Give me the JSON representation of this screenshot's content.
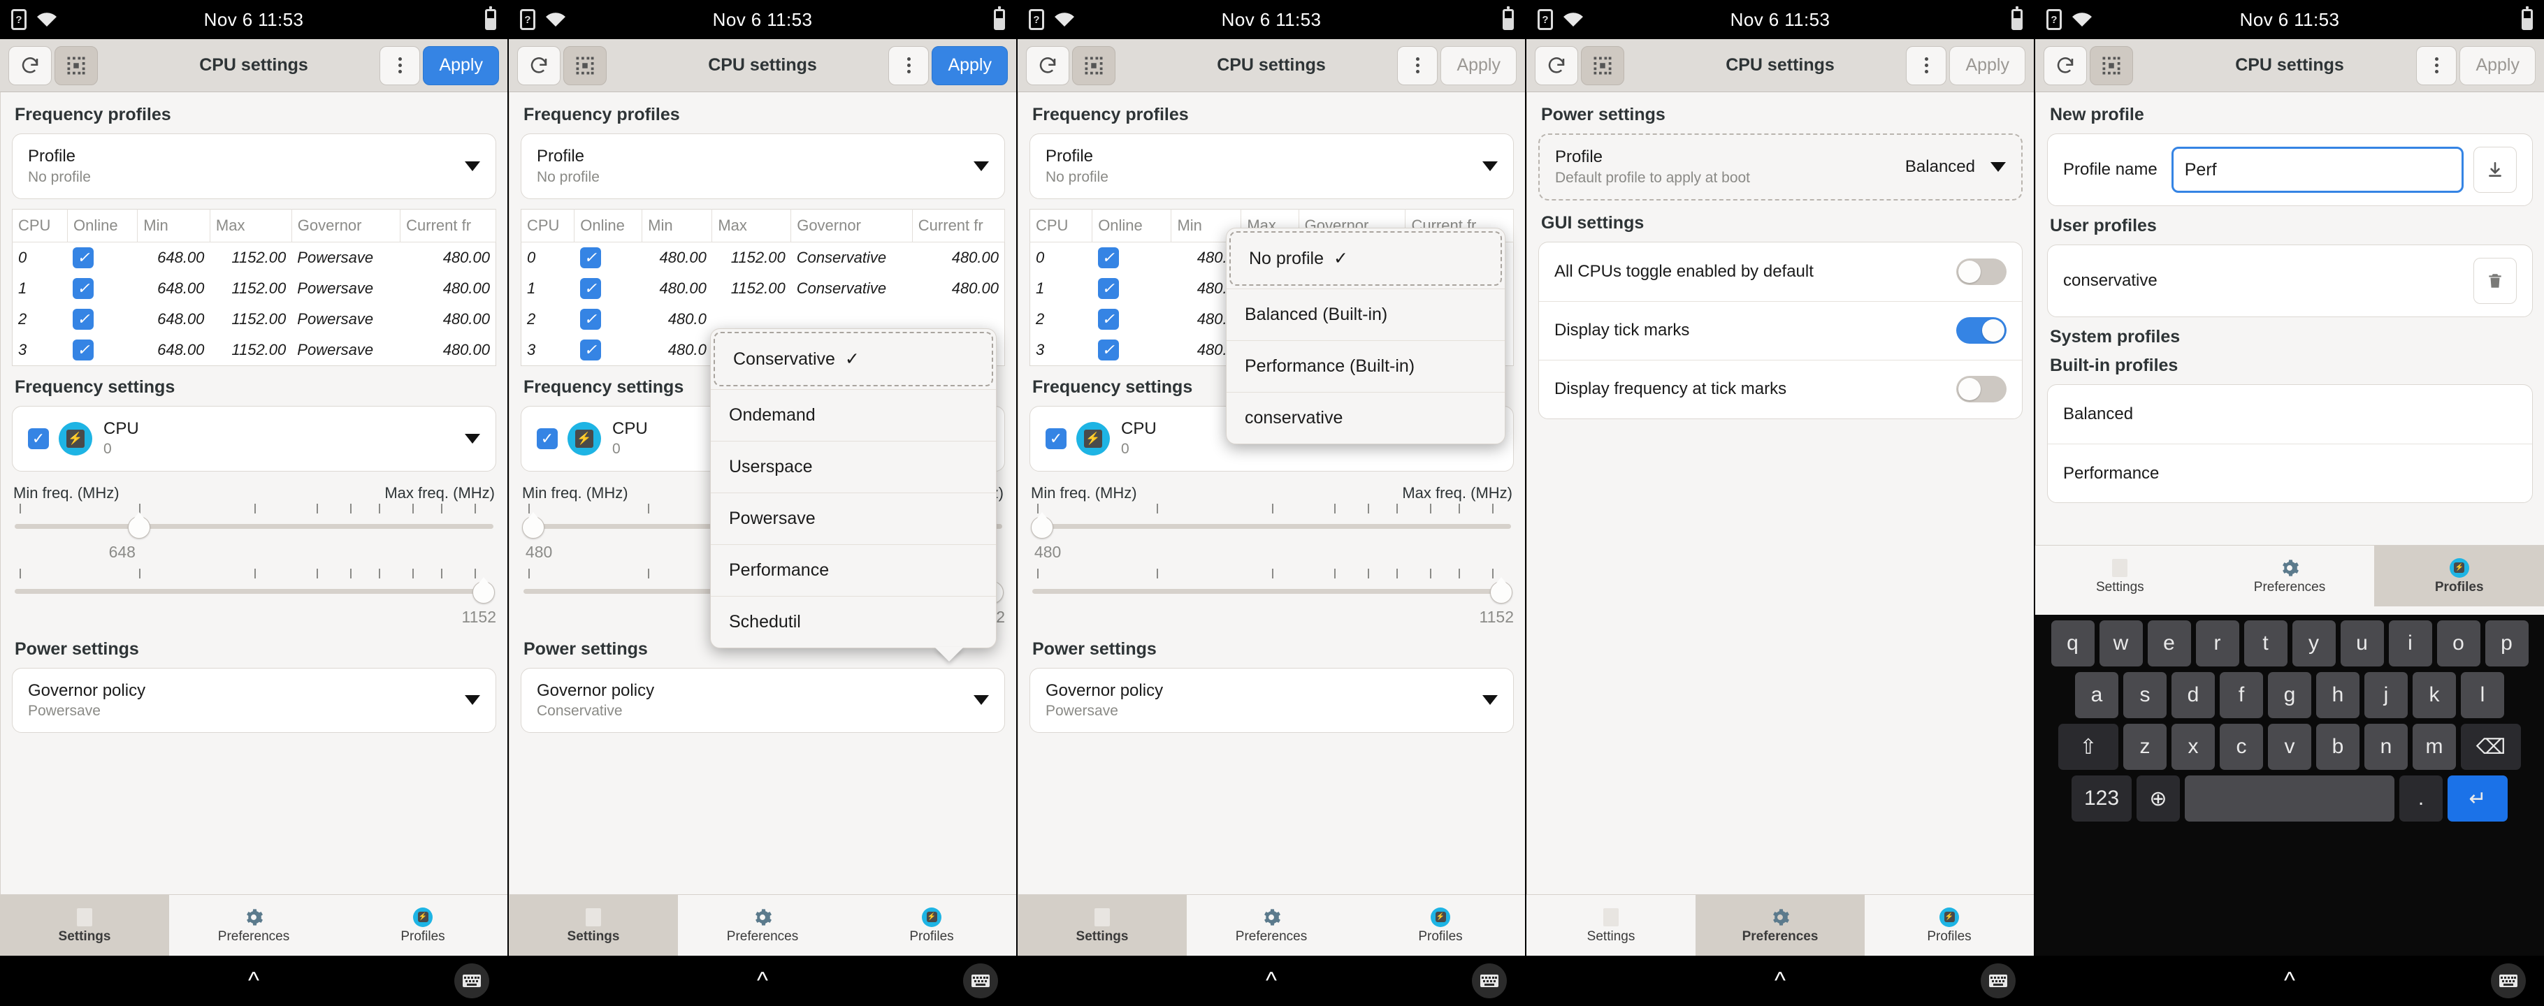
{
  "statusbar": {
    "clock": "Nov 6  11:53",
    "sim_icon": "?",
    "wifi_icon": "wifi-icon",
    "battery_icon": "battery-icon"
  },
  "header": {
    "title": "CPU settings",
    "refresh_icon": "refresh-icon",
    "selectall_icon": "select-all-icon",
    "menu_icon": "overflow-menu-icon",
    "apply_label": "Apply"
  },
  "tabbar": {
    "settings": "Settings",
    "preferences": "Preferences",
    "profiles": "Profiles"
  },
  "navbar": {
    "up_icon": "chevron-up-icon",
    "keyboard_icon": "keyboard-icon"
  },
  "sections": {
    "frequency_profiles": "Frequency profiles",
    "frequency_settings": "Frequency settings",
    "power_settings": "Power settings",
    "gui_settings": "GUI settings",
    "new_profile": "New profile",
    "user_profiles": "User profiles",
    "system_profiles": "System profiles",
    "builtin_profiles": "Built-in profiles"
  },
  "profile_row": {
    "title": "Profile",
    "value_none": "No profile"
  },
  "governor_row": {
    "title": "Governor policy",
    "value_powersave": "Powersave",
    "value_conservative": "Conservative"
  },
  "cpu_row": {
    "title": "CPU",
    "index": "0",
    "icon": "cpu-chip-icon"
  },
  "sliders": {
    "min_label": "Min freq. (MHz)",
    "max_label": "Max freq. (MHz)",
    "p1_min_value": "648",
    "p1_max_value": "1152",
    "p2_min_value": "480",
    "p3_min_value": "480",
    "p3_max_value": "1152",
    "min_pct_648": 26,
    "min_pct_480": 2,
    "max_pct_1152": 98
  },
  "table": {
    "headers": [
      "CPU",
      "Online",
      "Min",
      "Max",
      "Governor",
      "Current fr"
    ],
    "panel1_rows": [
      {
        "cpu": "0",
        "online": true,
        "min": "648.00",
        "max": "1152.00",
        "governor": "Powersave",
        "current": "480.00"
      },
      {
        "cpu": "1",
        "online": true,
        "min": "648.00",
        "max": "1152.00",
        "governor": "Powersave",
        "current": "480.00"
      },
      {
        "cpu": "2",
        "online": true,
        "min": "648.00",
        "max": "1152.00",
        "governor": "Powersave",
        "current": "480.00"
      },
      {
        "cpu": "3",
        "online": true,
        "min": "648.00",
        "max": "1152.00",
        "governor": "Powersave",
        "current": "480.00"
      }
    ],
    "panel2_rows": [
      {
        "cpu": "0",
        "online": true,
        "min": "480.00",
        "max": "1152.00",
        "governor": "Conservative",
        "current": "480.00"
      },
      {
        "cpu": "1",
        "online": true,
        "min": "480.00",
        "max": "1152.00",
        "governor": "Conservative",
        "current": "480.00"
      },
      {
        "cpu": "2",
        "online": true,
        "min": "480.0",
        "max": "",
        "governor": "",
        "current": ""
      },
      {
        "cpu": "3",
        "online": true,
        "min": "480.0",
        "max": "",
        "governor": "",
        "current": ""
      }
    ],
    "panel3_rows": [
      {
        "cpu": "0",
        "online": true,
        "min": "480.0",
        "max": "",
        "governor": "",
        "current": ""
      },
      {
        "cpu": "1",
        "online": true,
        "min": "480.0",
        "max": "",
        "governor": "",
        "current": ""
      },
      {
        "cpu": "2",
        "online": true,
        "min": "480.0",
        "max": "",
        "governor": "",
        "current": ""
      },
      {
        "cpu": "3",
        "online": true,
        "min": "480.0",
        "max": "",
        "governor": "",
        "current": ""
      }
    ]
  },
  "governor_popover": {
    "items": [
      "Conservative",
      "Ondemand",
      "Userspace",
      "Powersave",
      "Performance",
      "Schedutil"
    ],
    "selected": "Conservative",
    "check_icon": "check-icon"
  },
  "profile_popover": {
    "items": [
      "No profile",
      "Balanced (Built-in)",
      "Performance (Built-in)",
      "conservative"
    ],
    "selected": "No profile",
    "check_icon": "check-icon"
  },
  "preferences": {
    "profile_title": "Profile",
    "profile_sub": "Default profile to apply at boot",
    "profile_value": "Balanced",
    "toggles": [
      {
        "label": "All CPUs toggle enabled by default",
        "on": false
      },
      {
        "label": "Display tick marks",
        "on": true
      },
      {
        "label": "Display frequency at tick marks",
        "on": false
      }
    ]
  },
  "profiles_page": {
    "profile_name_label": "Profile name",
    "profile_name_value": "Perf",
    "save_icon": "download-save-icon",
    "user_profiles": [
      {
        "name": "conservative",
        "delete_icon": "trash-icon"
      }
    ],
    "builtin_profiles": [
      "Balanced",
      "Performance"
    ]
  },
  "keyboard": {
    "row1": [
      "q",
      "w",
      "e",
      "r",
      "t",
      "y",
      "u",
      "i",
      "o",
      "p"
    ],
    "row2": [
      "a",
      "s",
      "d",
      "f",
      "g",
      "h",
      "j",
      "k",
      "l"
    ],
    "row3_shift": "shift-icon",
    "row3": [
      "z",
      "x",
      "c",
      "v",
      "b",
      "n",
      "m"
    ],
    "row3_backspace": "backspace-icon",
    "row4_numbers": "123",
    "row4_globe": "globe-icon",
    "row4_space": "",
    "row4_period": ".",
    "row4_enter": "enter-icon"
  },
  "colors": {
    "accent": "#3584e4",
    "cpu_cyan": "#1eb4e4",
    "header_bg": "#dfdcd8",
    "page_bg": "#f6f5f4"
  }
}
